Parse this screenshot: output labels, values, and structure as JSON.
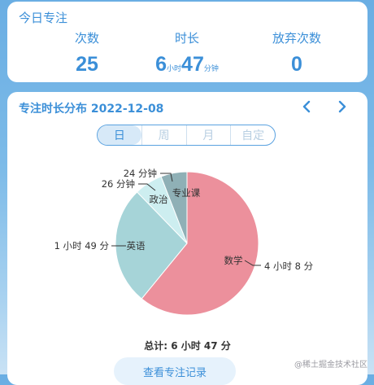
{
  "today": {
    "title": "今日专注",
    "count_label": "次数",
    "count_value": "25",
    "duration_label": "时长",
    "duration_hours": "6",
    "duration_hours_unit": "小时",
    "duration_minutes": "47",
    "duration_minutes_unit": "分钟",
    "giveup_label": "放弃次数",
    "giveup_value": "0"
  },
  "distribution": {
    "title": "专注时长分布 2022-12-08",
    "prev_icon": "chevron-left-icon",
    "next_icon": "chevron-right-icon",
    "tabs": [
      {
        "label": "日",
        "active": true
      },
      {
        "label": "周",
        "active": false
      },
      {
        "label": "月",
        "active": false
      },
      {
        "label": "自定",
        "active": false
      }
    ],
    "total": "总计: 6 小时 47 分",
    "record_button": "查看专注记录"
  },
  "chart_data": {
    "type": "pie",
    "unit": "minutes",
    "slices": [
      {
        "name": "数学",
        "value": 248,
        "value_label": "4 小时 8 分",
        "color": "#ec909c"
      },
      {
        "name": "英语",
        "value": 109,
        "value_label": "1 小时 49 分",
        "color": "#a6d4d8"
      },
      {
        "name": "政治",
        "value": 26,
        "value_label": "26 分钟",
        "color": "#cdeef0"
      },
      {
        "name": "专业课",
        "value": 24,
        "value_label": "24 分钟",
        "color": "#8fb0b6"
      }
    ]
  },
  "colors": {
    "accent": "#3b8fd8",
    "card": "#ffffff"
  },
  "watermark": "@稀土掘金技术社区"
}
